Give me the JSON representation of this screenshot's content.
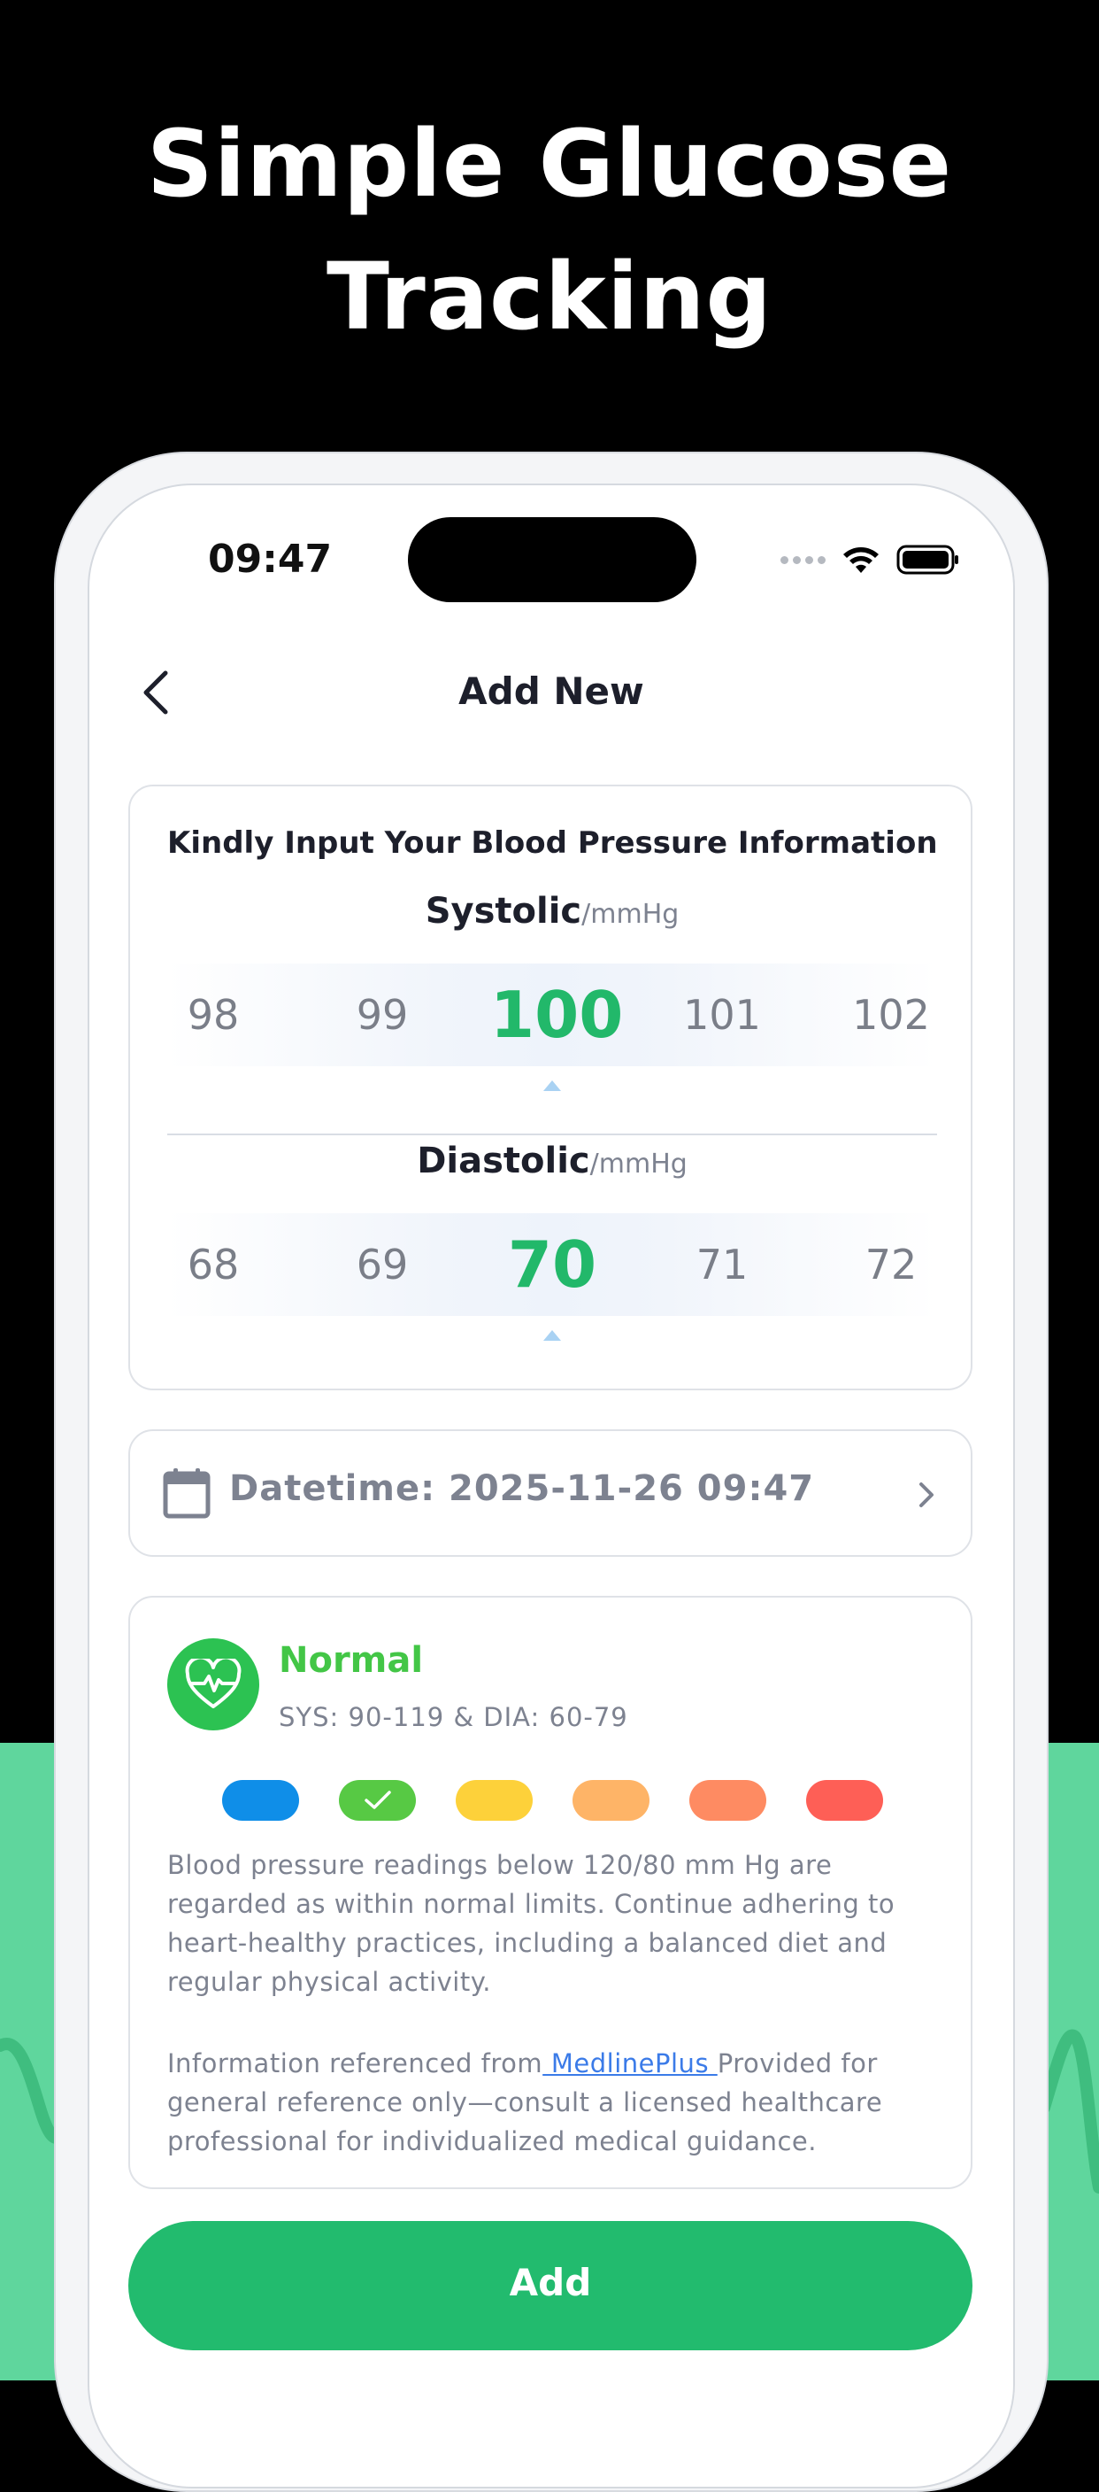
{
  "headline": {
    "line1": "Simple Glucose",
    "line2": "Tracking"
  },
  "status_bar": {
    "time": "09:47"
  },
  "nav": {
    "title": "Add New"
  },
  "bp_card": {
    "title": "Kindly Input Your Blood Pressure Information",
    "systolic": {
      "label": "Systolic",
      "unit": "/mmHg",
      "values": [
        "98",
        "99",
        "100",
        "101",
        "102"
      ],
      "selected": "100"
    },
    "diastolic": {
      "label": "Diastolic",
      "unit": "/mmHg",
      "values": [
        "68",
        "69",
        "70",
        "71",
        "72"
      ],
      "selected": "70"
    }
  },
  "datetime": {
    "label": "Datetime: 2025-11-26 09:47"
  },
  "result": {
    "name": "Normal",
    "range": "SYS: 90-119 & DIA: 60-79",
    "levels": [
      "#0f8ee8",
      "#57c944",
      "#fdd13a",
      "#feb467",
      "#fe8b62",
      "#fe5f56"
    ],
    "selected_level": 1,
    "description": "Blood pressure readings below 120/80 mm Hg are regarded as within normal limits. Continue adhering to heart-healthy practices, including a balanced diet and regular physical activity.",
    "source_prefix": "Information referenced from",
    "source_link": " MedlinePlus ",
    "source_suffix": "Provided for general reference only—consult a licensed healthcare professional for individualized medical guidance."
  },
  "add_button": {
    "label": "Add"
  },
  "colors": {
    "accent_green": "#22bb6e",
    "normal_green": "#43c646",
    "background_green": "#5fd69d"
  }
}
